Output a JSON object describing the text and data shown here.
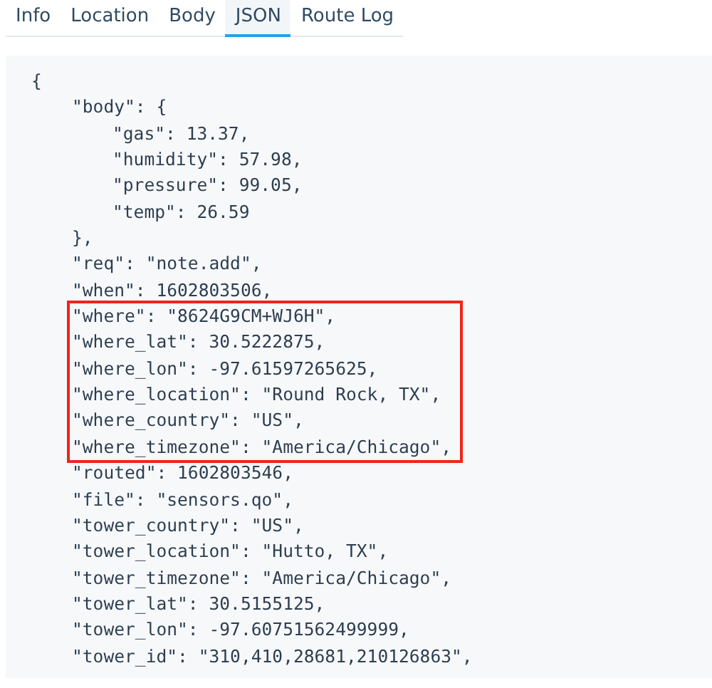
{
  "tabs": [
    {
      "label": "Info",
      "selected": false
    },
    {
      "label": "Location",
      "selected": false
    },
    {
      "label": "Body",
      "selected": false
    },
    {
      "label": "JSON",
      "selected": true
    },
    {
      "label": "Route Log",
      "selected": false
    }
  ],
  "json_view": {
    "lines": [
      {
        "kind": "line",
        "text": "{",
        "children": [
          {
            "kind": "line",
            "text": "\"body\": {",
            "children": [
              {
                "kind": "line",
                "text": "\"gas\": 13.37,"
              },
              {
                "kind": "line",
                "text": "\"humidity\": 57.98,"
              },
              {
                "kind": "line",
                "text": "\"pressure\": 99.05,"
              },
              {
                "kind": "line",
                "text": "\"temp\": 26.59"
              }
            ]
          },
          {
            "kind": "line",
            "text": "},"
          },
          {
            "kind": "line",
            "text": "\"req\": \"note.add\","
          },
          {
            "kind": "line",
            "text": "\"when\": 1602803506,"
          },
          {
            "kind": "highlight",
            "lines": [
              {
                "text": "\"where\": \"8624G9CM+WJ6H\","
              },
              {
                "text": "\"where_lat\": 30.5222875,"
              },
              {
                "text": "\"where_lon\": -97.61597265625,"
              },
              {
                "text": "\"where_location\": \"Round Rock, TX\","
              },
              {
                "text": "\"where_country\": \"US\","
              },
              {
                "text": "\"where_timezone\": \"America/Chicago\","
              }
            ]
          },
          {
            "kind": "line",
            "text": "\"routed\": 1602803546,"
          },
          {
            "kind": "line",
            "text": "\"file\": \"sensors.qo\","
          },
          {
            "kind": "line",
            "text": "\"tower_country\": \"US\","
          },
          {
            "kind": "line",
            "text": "\"tower_location\": \"Hutto, TX\","
          },
          {
            "kind": "line",
            "text": "\"tower_timezone\": \"America/Chicago\","
          },
          {
            "kind": "line",
            "text": "\"tower_lat\": 30.5155125,"
          },
          {
            "kind": "line",
            "text": "\"tower_lon\": -97.60751562499999,"
          },
          {
            "kind": "line",
            "text": "\"tower_id\": \"310,410,28681,210126863\","
          }
        ]
      }
    ]
  }
}
